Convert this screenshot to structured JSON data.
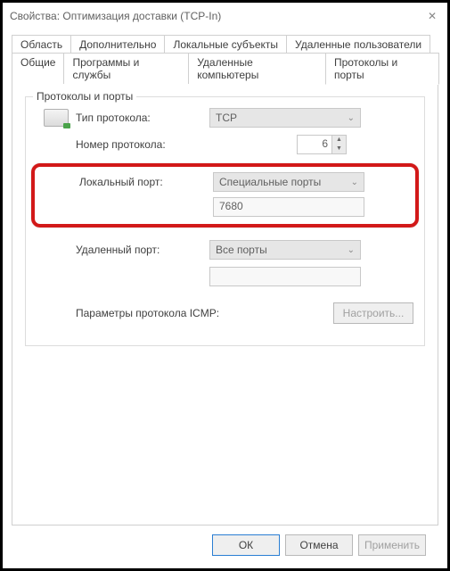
{
  "window": {
    "title": "Свойства: Оптимизация доставки (TCP-In)"
  },
  "tabs": {
    "row1": [
      "Область",
      "Дополнительно",
      "Локальные субъекты",
      "Удаленные пользователи"
    ],
    "row2": [
      "Общие",
      "Программы и службы",
      "Удаленные компьютеры",
      "Протоколы и порты"
    ],
    "active": "Протоколы и порты"
  },
  "group": {
    "legend": "Протоколы и порты",
    "protocol_type_label": "Тип протокола:",
    "protocol_type_value": "TCP",
    "protocol_number_label": "Номер протокола:",
    "protocol_number_value": "6",
    "local_port_label": "Локальный порт:",
    "local_port_select": "Специальные порты",
    "local_port_value": "7680",
    "remote_port_label": "Удаленный порт:",
    "remote_port_select": "Все порты",
    "remote_port_value": "",
    "icmp_label": "Параметры протокола ICMP:",
    "icmp_button": "Настроить..."
  },
  "footer": {
    "ok": "ОК",
    "cancel": "Отмена",
    "apply": "Применить"
  }
}
